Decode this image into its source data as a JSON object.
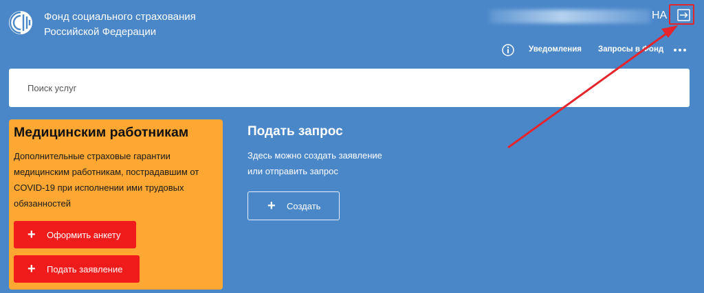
{
  "header": {
    "org_name_line1": "Фонд социального страхования",
    "org_name_line2": "Российской Федерации",
    "user_initials": "НА",
    "logout_icon": "logout-icon",
    "info_icon": "info-icon",
    "more_icon": "more-horizontal-icon"
  },
  "nav": {
    "notifications": "Уведомления",
    "requests": "Запросы в Фонд"
  },
  "search": {
    "placeholder": "Поиск услуг"
  },
  "medical_card": {
    "title": "Медицинским работникам",
    "description": "Дополнительные страховые гарантии медицинским работникам, пострадавшим от COVID-19 при исполнении ими трудовых обязанностей",
    "fill_form_button": "Оформить анкету",
    "submit_application_button": "Подать заявление"
  },
  "submit_request": {
    "title": "Подать запрос",
    "description_line1": "Здесь можно создать заявление",
    "description_line2": "или отправить запрос",
    "create_button": "Создать"
  },
  "colors": {
    "background": "#4a87c9",
    "card": "#ffa733",
    "red_button": "#f01b1b",
    "annotation": "#e5242b"
  }
}
